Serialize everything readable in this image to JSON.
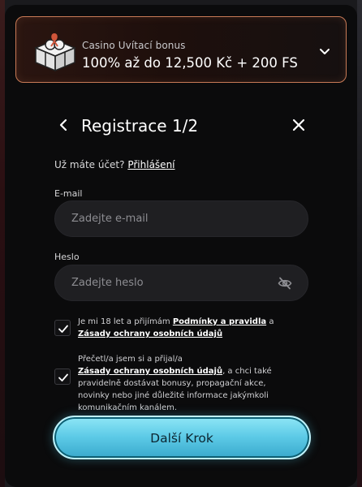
{
  "bonus": {
    "subtitle": "Casino Uvítací bonus",
    "title": "100% až do 12,500 Kč + 200 FS",
    "gift_icon": "gift-box-icon",
    "chevron_icon": "chevron-down-icon"
  },
  "header": {
    "title": "Registrace 1/2",
    "back_icon": "chevron-left-icon",
    "close_icon": "close-icon"
  },
  "account": {
    "prompt": "Už máte účet?",
    "login_link": "Přihlášení"
  },
  "email": {
    "label": "E-mail",
    "placeholder": "Zadejte e-mail"
  },
  "password": {
    "label": "Heslo",
    "placeholder": "Zadejte heslo",
    "visibility_icon": "eye-off-icon"
  },
  "consent_terms": {
    "checked": true,
    "text_before": "Je mi 18 let a přijímám",
    "terms_link": "Podmínky a pravidla",
    "text_and": "a",
    "privacy_link": "Zásady ochrany osobních údajů"
  },
  "consent_marketing": {
    "checked": true,
    "text_before": "Přečetl/a jsem si a přijal/a",
    "privacy_link": "Zásady ochrany osobních údajů",
    "text_after": ", a chci také pravidelně dostávat bonusy, propagační akce, novinky nebo jiné důležité informace jakýmkoli komunikačním kanálem."
  },
  "cta": {
    "label": "Další Krok"
  },
  "colors": {
    "accent_border": "#c87a56",
    "cta_gradient_top": "#8ee6f6",
    "cta_gradient_bottom": "#3aa9cc",
    "panel_bg": "#0b0b0c"
  }
}
